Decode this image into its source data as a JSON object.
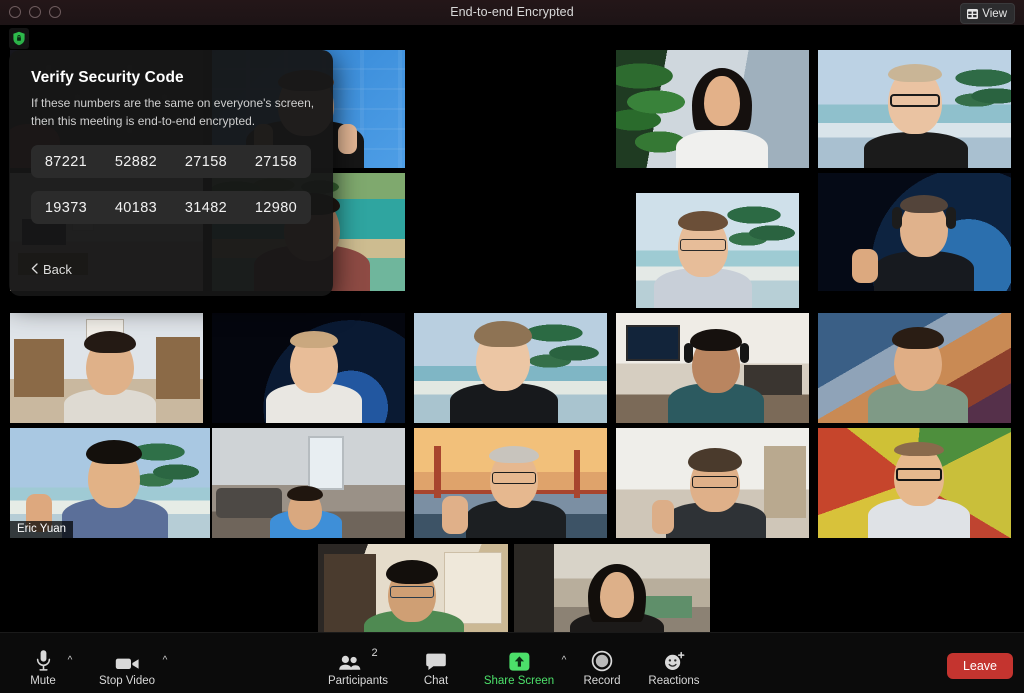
{
  "window": {
    "title": "End-to-end Encrypted",
    "traffic_lights": [
      "close",
      "minimize",
      "zoom"
    ],
    "view_button": {
      "label": "View",
      "icon": "grid-view-icon"
    },
    "encryption_indicator": {
      "icon": "green-shield-lock-icon",
      "color": "#3ccf5c"
    }
  },
  "security_popover": {
    "title": "Verify Security Code",
    "description": "If these numbers are the same on everyone's screen, then this meeting is end-to-end encrypted.",
    "code_rows": [
      [
        "87221",
        "52882",
        "27158",
        "27158"
      ],
      [
        "19373",
        "40183",
        "31482",
        "12980"
      ]
    ],
    "back_label": "Back",
    "back_icon": "chevron-left-icon"
  },
  "gallery": {
    "active_speaker_border_color": "#d6e66a",
    "rows": [
      {
        "tiles": [
          {
            "name_label": "",
            "background": "zoom-logo-wall",
            "speaking": false
          },
          {
            "name_label": "",
            "background": "zoom-branded-blue",
            "speaking": false
          },
          {
            "name_label": "",
            "background": "plant-city-window",
            "speaking": false
          },
          {
            "name_label": "",
            "background": "beach-palms",
            "speaking": false
          }
        ]
      },
      {
        "tiles": [
          {
            "name_label": "",
            "background": "living-room",
            "speaking": false
          },
          {
            "name_label": "",
            "background": "tropical-lagoon",
            "speaking": false
          },
          {
            "name_label": "",
            "background": "beach-palm-tree",
            "speaking": false
          },
          {
            "name_label": "",
            "background": "space-earth",
            "speaking": false
          }
        ]
      },
      {
        "tiles": [
          {
            "name_label": "",
            "background": "home-bookshelf",
            "speaking": false
          },
          {
            "name_label": "",
            "background": "space-earth-dark",
            "speaking": false
          },
          {
            "name_label": "",
            "background": "beach-palm-sky",
            "speaking": false
          },
          {
            "name_label": "",
            "background": "office-tv-desk",
            "speaking": false
          },
          {
            "name_label": "",
            "background": "abstract-wave-art",
            "speaking": false
          }
        ]
      },
      {
        "tiles": [
          {
            "name_label": "Eric Yuan",
            "background": "beach-palm-thumbsup",
            "speaking": true
          },
          {
            "name_label": "",
            "background": "modern-loft",
            "speaking": false
          },
          {
            "name_label": "",
            "background": "golden-gate-bridge",
            "speaking": false
          },
          {
            "name_label": "",
            "background": "plain-room",
            "speaking": false
          },
          {
            "name_label": "",
            "background": "respect-justice-poster",
            "speaking": false
          }
        ]
      },
      {
        "tiles": [
          {
            "name_label": "",
            "background": "home-shelves-warm",
            "speaking": false
          },
          {
            "name_label": "",
            "background": "open-office",
            "speaking": false
          }
        ]
      }
    ]
  },
  "toolbar": {
    "mute": {
      "label": "Mute",
      "icon": "microphone-icon",
      "has_caret": true
    },
    "video": {
      "label": "Stop Video",
      "icon": "camera-icon",
      "has_caret": true
    },
    "participants": {
      "label": "Participants",
      "icon": "people-icon",
      "count": "2"
    },
    "chat": {
      "label": "Chat",
      "icon": "speech-bubble-icon"
    },
    "share_screen": {
      "label": "Share Screen",
      "icon": "share-arrow-up-icon",
      "color": "#4ce06a",
      "has_caret": true
    },
    "record": {
      "label": "Record",
      "icon": "record-circle-icon"
    },
    "reactions": {
      "label": "Reactions",
      "icon": "smiley-plus-icon"
    },
    "leave": {
      "label": "Leave",
      "color": "#c4342f"
    }
  }
}
